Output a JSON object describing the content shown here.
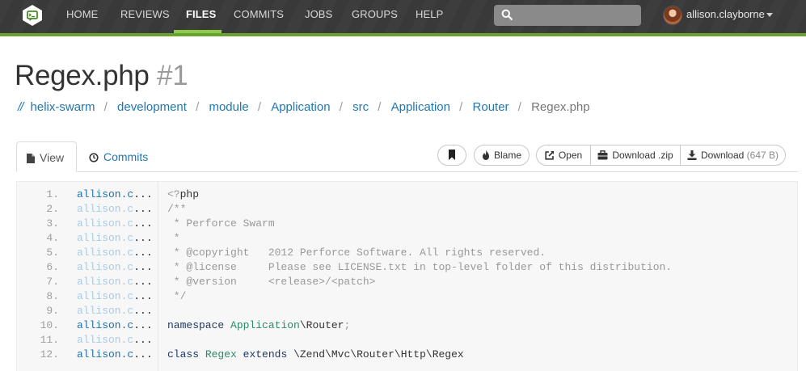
{
  "nav": {
    "items": [
      "HOME",
      "REVIEWS",
      "FILES",
      "COMMITS",
      "JOBS",
      "GROUPS",
      "HELP"
    ],
    "active": "FILES",
    "search_placeholder": "",
    "username": "allison.clayborne"
  },
  "page": {
    "title": "Regex.php",
    "title_number": "#1"
  },
  "breadcrumb": {
    "root": "//",
    "links": [
      "helix-swarm",
      "development",
      "module",
      "Application",
      "src",
      "Application",
      "Router"
    ],
    "current": "Regex.php",
    "separator": "/"
  },
  "tabs": {
    "view": "View",
    "commits": "Commits"
  },
  "actions": {
    "blame": "Blame",
    "open": "Open",
    "download_zip": "Download .zip",
    "download": "Download",
    "download_size": "(647 B)"
  },
  "code": {
    "author_truncated": "allison.c",
    "ellipsis": "...",
    "lines": [
      {
        "n": "1.",
        "emph": true,
        "text": "<?php"
      },
      {
        "n": "2.",
        "emph": false,
        "text": "/**"
      },
      {
        "n": "3.",
        "emph": false,
        "text": " * Perforce Swarm"
      },
      {
        "n": "4.",
        "emph": false,
        "text": " *"
      },
      {
        "n": "5.",
        "emph": false,
        "text": " * @copyright   2012 Perforce Software. All rights reserved."
      },
      {
        "n": "6.",
        "emph": false,
        "text": " * @license     Please see LICENSE.txt in top-level folder of this distribution."
      },
      {
        "n": "7.",
        "emph": false,
        "text": " * @version     <release>/<patch>"
      },
      {
        "n": "8.",
        "emph": false,
        "text": " */"
      },
      {
        "n": "9.",
        "emph": false,
        "text": ""
      },
      {
        "n": "10.",
        "emph": true,
        "text": "namespace Application\\Router;"
      },
      {
        "n": "11.",
        "emph": false,
        "text": ""
      },
      {
        "n": "12.",
        "emph": true,
        "text": "class Regex extends \\Zend\\Mvc\\Router\\Http\\Regex"
      }
    ]
  },
  "colors": {
    "navbar": "#3a3a3a",
    "accent_green": "#6aa22f",
    "link_blue": "#1f78b4"
  }
}
